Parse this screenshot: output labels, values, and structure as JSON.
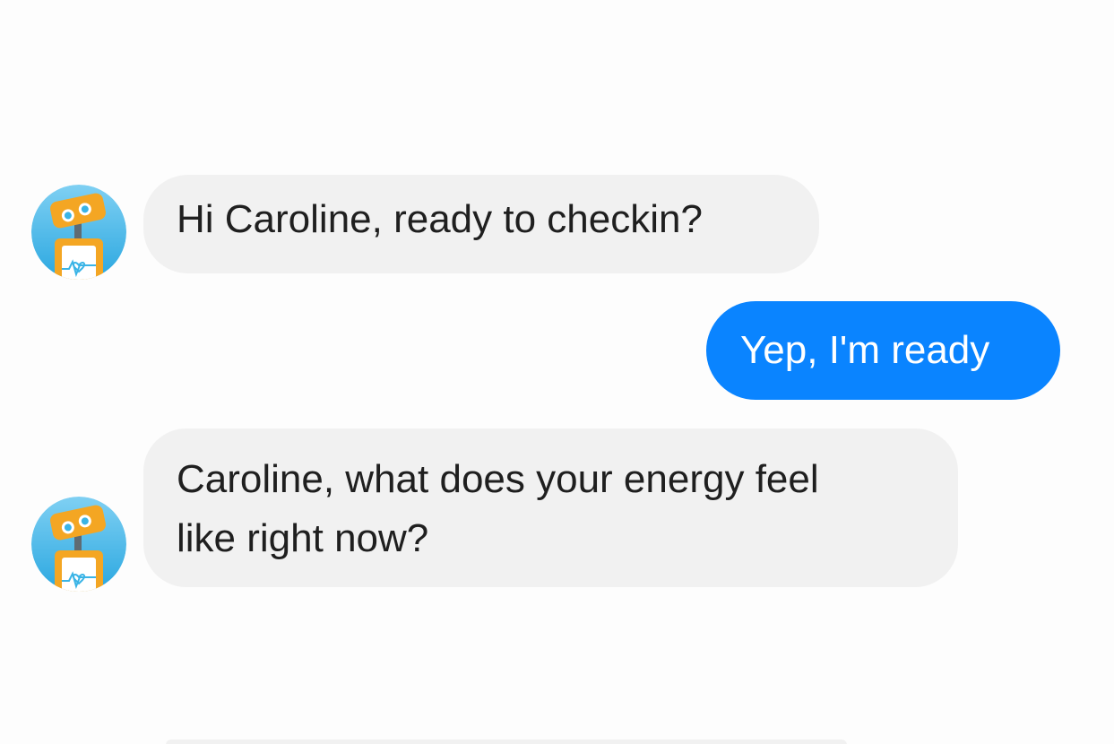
{
  "conversation": {
    "messages": [
      {
        "sender": "bot",
        "text": "Hi Caroline, ready to checkin?"
      },
      {
        "sender": "user",
        "text": "Yep, I'm ready"
      },
      {
        "sender": "bot",
        "lines": [
          "Caroline, what does your energy feel",
          "like right now?"
        ]
      }
    ]
  },
  "avatar": {
    "icon": "robot-bot-icon"
  },
  "colors": {
    "incoming_bubble": "#f1f1f1",
    "outgoing_bubble": "#0a84ff",
    "incoming_text": "#1f1f1f",
    "outgoing_text": "#ffffff",
    "background": "#fdfdfd"
  }
}
